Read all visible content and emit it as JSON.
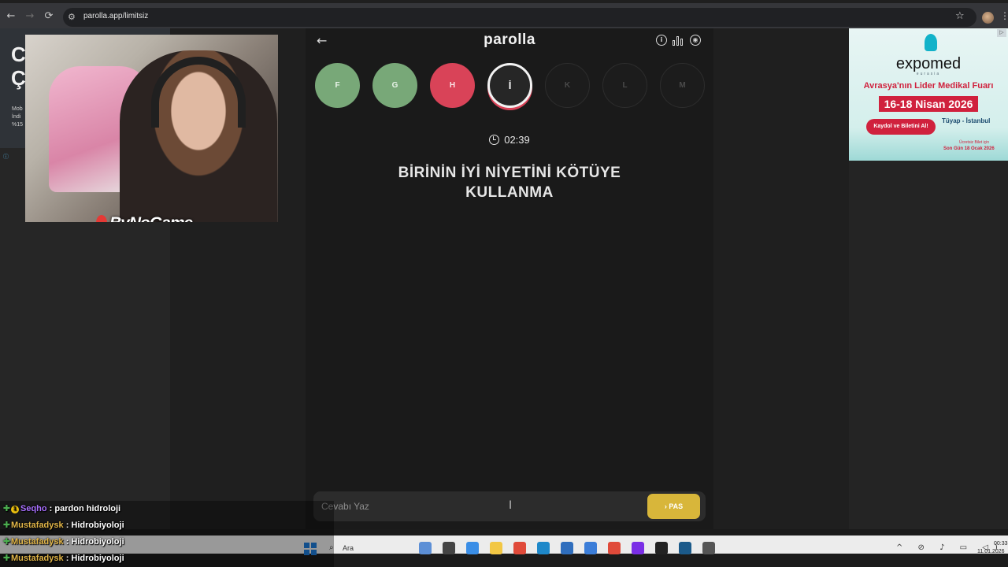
{
  "browser": {
    "url": "parolla.app/limitsiz",
    "back_icon": "←",
    "forward_icon": "→",
    "reload_icon": "⟳",
    "star_icon": "☆",
    "menu_icon": "⋮"
  },
  "left_ad": {
    "heading": "C Ç",
    "text": "Mob İndi %15",
    "info": "ⓘ"
  },
  "webcam": {
    "logo": "ByNoGame"
  },
  "game": {
    "logo": "parolla",
    "back_icon": "←",
    "letters": [
      {
        "char": "F",
        "state": "correct"
      },
      {
        "char": "G",
        "state": "correct"
      },
      {
        "char": "H",
        "state": "wrong"
      },
      {
        "char": "İ",
        "state": "current"
      },
      {
        "char": "K",
        "state": "pending"
      },
      {
        "char": "L",
        "state": "pending"
      },
      {
        "char": "M",
        "state": "pending"
      }
    ],
    "timer": "02:39",
    "question": "BİRİNİN İYİ NİYETİNİ KÖTÜYE KULLANMA",
    "answer_placeholder": "Cevabı Yaz",
    "pass_label": "PAS",
    "pass_icon": "›",
    "info_icon": "i",
    "profile_icon": "◉"
  },
  "right_ad": {
    "brand": "expomed",
    "sub": "eurasia",
    "line1": "Avrasya'nın Lider Medikal Fuarı",
    "dates": "16-18 Nisan 2026",
    "cta": "Kaydol ve Biletini Al!",
    "location": "Tüyap - İstanbul",
    "note1": "Ücretsiz Bilet için",
    "note2": "Son Gün 18 Ocak 2026",
    "close_icon": "▷",
    "colors": {
      "accent": "#d0213d",
      "brand": "#12b2c9"
    }
  },
  "chat": [
    {
      "user": "Seqho",
      "message": " : pardon hidroloji",
      "badge": "1",
      "color": "purple"
    },
    {
      "user": "Mustafadysk",
      "message": " : Hidrobiyoloji",
      "color": "gold"
    },
    {
      "user": "Mustafadysk",
      "message": " : Hidrobiyoloji",
      "color": "gold"
    },
    {
      "user": "Mustafadysk",
      "message": " : Hidrobiyoloji",
      "color": "gold"
    }
  ],
  "taskbar": {
    "search_label": "Ara",
    "search_icon": "⌕",
    "tray_icons": "^ ⊘ ♪ ▭ ◁)",
    "time": "00:33",
    "date": "11.01.2026",
    "apps": [
      {
        "name": "widgets-app-icon",
        "color": "#5c8fd6"
      },
      {
        "name": "file-explorer-app-icon",
        "color": "#444444"
      },
      {
        "name": "store-app-icon",
        "color": "#3a8ee6"
      },
      {
        "name": "folder-app-icon",
        "color": "#f2c744"
      },
      {
        "name": "chrome-app-icon",
        "color": "#e04a3a"
      },
      {
        "name": "edge-app-icon",
        "color": "#1e88c9"
      },
      {
        "name": "calendar-app-icon",
        "color": "#2f6ebd"
      },
      {
        "name": "mail-app-icon",
        "color": "#3b7dd8"
      },
      {
        "name": "chrome-active-app-icon",
        "color": "#e04a3a"
      },
      {
        "name": "bootstrap-app-icon",
        "color": "#7a2ee6"
      },
      {
        "name": "obs-app-icon",
        "color": "#222222"
      },
      {
        "name": "steam-app-icon",
        "color": "#1b5a8a"
      },
      {
        "name": "settings-app-icon",
        "color": "#555555"
      }
    ]
  }
}
